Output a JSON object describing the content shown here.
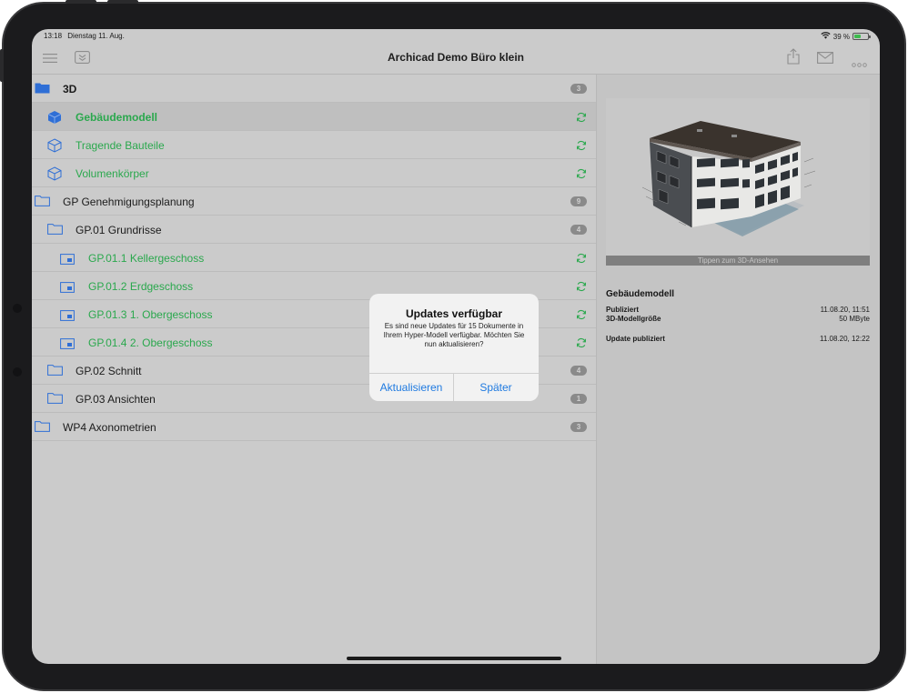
{
  "status_bar": {
    "time": "13:18",
    "date": "Dienstag 11. Aug.",
    "battery": "39 %"
  },
  "nav": {
    "title": "Archicad Demo Büro klein"
  },
  "list": {
    "rows": [
      {
        "label": "3D",
        "badge": "3"
      },
      {
        "label": "Gebäudemodell"
      },
      {
        "label": "Tragende Bauteile"
      },
      {
        "label": "Volumenkörper"
      },
      {
        "label": "GP Genehmigungsplanung",
        "badge": "9"
      },
      {
        "label": "GP.01 Grundrisse",
        "badge": "4"
      },
      {
        "label": "GP.01.1 Kellergeschoss"
      },
      {
        "label": "GP.01.2 Erdgeschoss"
      },
      {
        "label": "GP.01.3 1. Obergeschoss"
      },
      {
        "label": "GP.01.4 2. Obergeschoss"
      },
      {
        "label": "GP.02 Schnitt",
        "badge": "4"
      },
      {
        "label": "GP.03 Ansichten",
        "badge": "1"
      },
      {
        "label": "WP4 Axonometrien",
        "badge": "3"
      }
    ]
  },
  "detail": {
    "preview_caption": "Tippen zum 3D-Ansehen",
    "title": "Gebäudemodell",
    "published_label": "Publiziert",
    "published_value": "11.08.20, 11:51",
    "size_label": "3D-Modellgröße",
    "size_value": "50 MByte",
    "update_label": "Update publiziert",
    "update_value": "11.08.20, 12:22"
  },
  "alert": {
    "title": "Updates verfügbar",
    "message": "Es sind neue Updates für 15 Dokumente in Ihrem Hyper-Modell verfügbar. Möchten Sie nun aktualisieren?",
    "primary_button": "Aktualisieren",
    "secondary_button": "Später"
  },
  "colors": {
    "accent_green": "#2aa84d",
    "accent_blue": "#1f7ae0",
    "folder_blue": "#2f6fd6"
  }
}
